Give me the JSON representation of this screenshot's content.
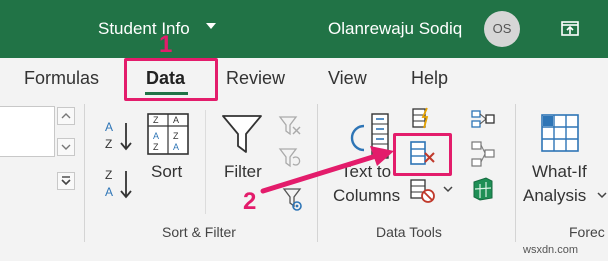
{
  "titlebar": {
    "workbook_name": "Student Info",
    "user_name": "Olanrewaju Sodiq",
    "avatar_initials": "OS"
  },
  "tabs": [
    {
      "label": "Formulas"
    },
    {
      "label": "Data"
    },
    {
      "label": "Review"
    },
    {
      "label": "View"
    },
    {
      "label": "Help"
    }
  ],
  "ribbon": {
    "sort_filter": {
      "sort_label": "Sort",
      "filter_label": "Filter",
      "group_label": "Sort & Filter"
    },
    "data_tools": {
      "text_to_columns_line1": "Text to",
      "text_to_columns_line2": "Columns",
      "group_label": "Data Tools"
    },
    "forecast": {
      "what_if_line1": "What-If",
      "what_if_line2": "Analysis",
      "group_label": "Forec"
    }
  },
  "annotations": {
    "step1": "1",
    "step2": "2"
  },
  "watermark": "wsxdn.com",
  "colors": {
    "excel_green": "#217346",
    "annotation_pink": "#e31c6b",
    "ribbon_bg": "#f3f3f3",
    "icon_blue": "#2e75b6",
    "icon_red": "#c0392b"
  }
}
